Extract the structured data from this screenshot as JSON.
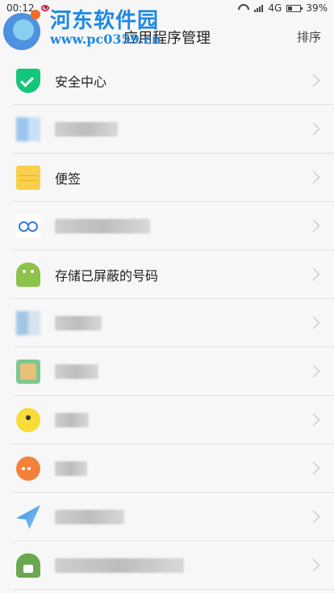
{
  "status_bar": {
    "time": "00:12",
    "network": "4G",
    "battery": "39%"
  },
  "watermark": {
    "title": "河东软件园",
    "url": "www.pc0359.cn"
  },
  "header": {
    "title": "应用程序管理",
    "sort_label": "排序"
  },
  "apps": [
    {
      "label": "安全中心",
      "icon": "shield-icon"
    },
    {
      "label": "",
      "icon": "blurred-icon"
    },
    {
      "label": "便签",
      "icon": "notes-icon"
    },
    {
      "label": "",
      "icon": "eyes-icon"
    },
    {
      "label": "存储已屏蔽的号码",
      "icon": "android-icon"
    },
    {
      "label": "",
      "icon": "blurred-icon"
    },
    {
      "label": "",
      "icon": "picture-frame-icon"
    },
    {
      "label": "",
      "icon": "yellow-bird-icon"
    },
    {
      "label": "",
      "icon": "chat-bubble-icon"
    },
    {
      "label": "",
      "icon": "paper-plane-icon"
    },
    {
      "label": "",
      "icon": "android-icon"
    }
  ]
}
